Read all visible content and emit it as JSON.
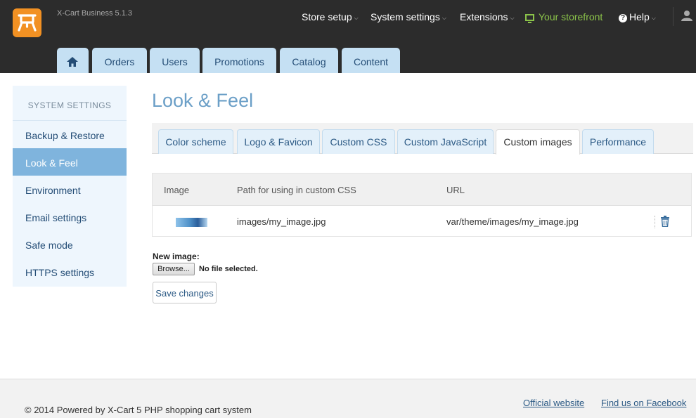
{
  "header": {
    "brand": "X-Cart Business 5.1.3",
    "nav": [
      {
        "label": "Store setup"
      },
      {
        "label": "System settings"
      },
      {
        "label": "Extensions"
      }
    ],
    "storefront": "Your storefront",
    "help": "Help",
    "tabs": [
      "Orders",
      "Users",
      "Promotions",
      "Catalog",
      "Content"
    ]
  },
  "sidebar": {
    "title": "SYSTEM SETTINGS",
    "items": [
      {
        "label": "Backup & Restore"
      },
      {
        "label": "Look & Feel",
        "active": true
      },
      {
        "label": "Environment"
      },
      {
        "label": "Email settings"
      },
      {
        "label": "Safe mode"
      },
      {
        "label": "HTTPS settings"
      }
    ]
  },
  "main": {
    "title": "Look & Feel",
    "subtabs": [
      "Color scheme",
      "Logo & Favicon",
      "Custom CSS",
      "Custom JavaScript",
      "Custom images",
      "Performance"
    ],
    "active_subtab": "Custom images",
    "table": {
      "headers": [
        "Image",
        "Path for using in custom CSS",
        "URL"
      ],
      "rows": [
        {
          "path": "images/my_image.jpg",
          "url": "var/theme/images/my_image.jpg"
        }
      ]
    },
    "new_image_label": "New image:",
    "browse_label": "Browse...",
    "no_file": "No file selected.",
    "save_label": "Save changes"
  },
  "footer": {
    "copyright": "© 2014 Powered by X-Cart 5 PHP shopping cart system",
    "links": [
      "Official website",
      "Find us on Facebook"
    ]
  },
  "colors": {
    "header_bg": "#2c2c2c",
    "logo": "#f29123",
    "tab_bg": "#c5e0f3",
    "active_sidebar": "#7fb4dd",
    "title": "#6b9fc7",
    "storefront": "#8bc34a"
  }
}
